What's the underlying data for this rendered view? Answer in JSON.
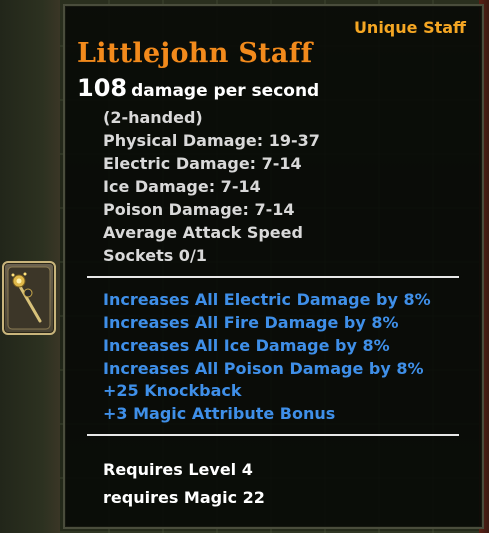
{
  "item": {
    "rarity": "Unique Staff",
    "name": "Littlejohn Staff",
    "dps_value": "108",
    "dps_label": "damage per second",
    "stats": [
      "(2-handed)",
      "Physical Damage: 19-37",
      "Electric Damage: 7-14",
      "Ice Damage: 7-14",
      "Poison Damage: 7-14",
      "Average Attack Speed",
      "Sockets 0/1"
    ],
    "bonuses": [
      "Increases All Electric Damage by 8%",
      "Increases All Fire Damage by 8%",
      "Increases All Ice Damage by 8%",
      "Increases All Poison Damage by 8%",
      "+25 Knockback",
      "+3 Magic Attribute Bonus"
    ],
    "requirements": [
      "Requires Level 4",
      "requires Magic 22"
    ]
  },
  "inventory_slot": {
    "icon": "staff-icon"
  },
  "colors": {
    "rarity": "#f5a623",
    "item_name": "#f28a1c",
    "stat": "#d9d9d9",
    "bonus": "#3f8fe8",
    "requirement": "#ffffff"
  }
}
